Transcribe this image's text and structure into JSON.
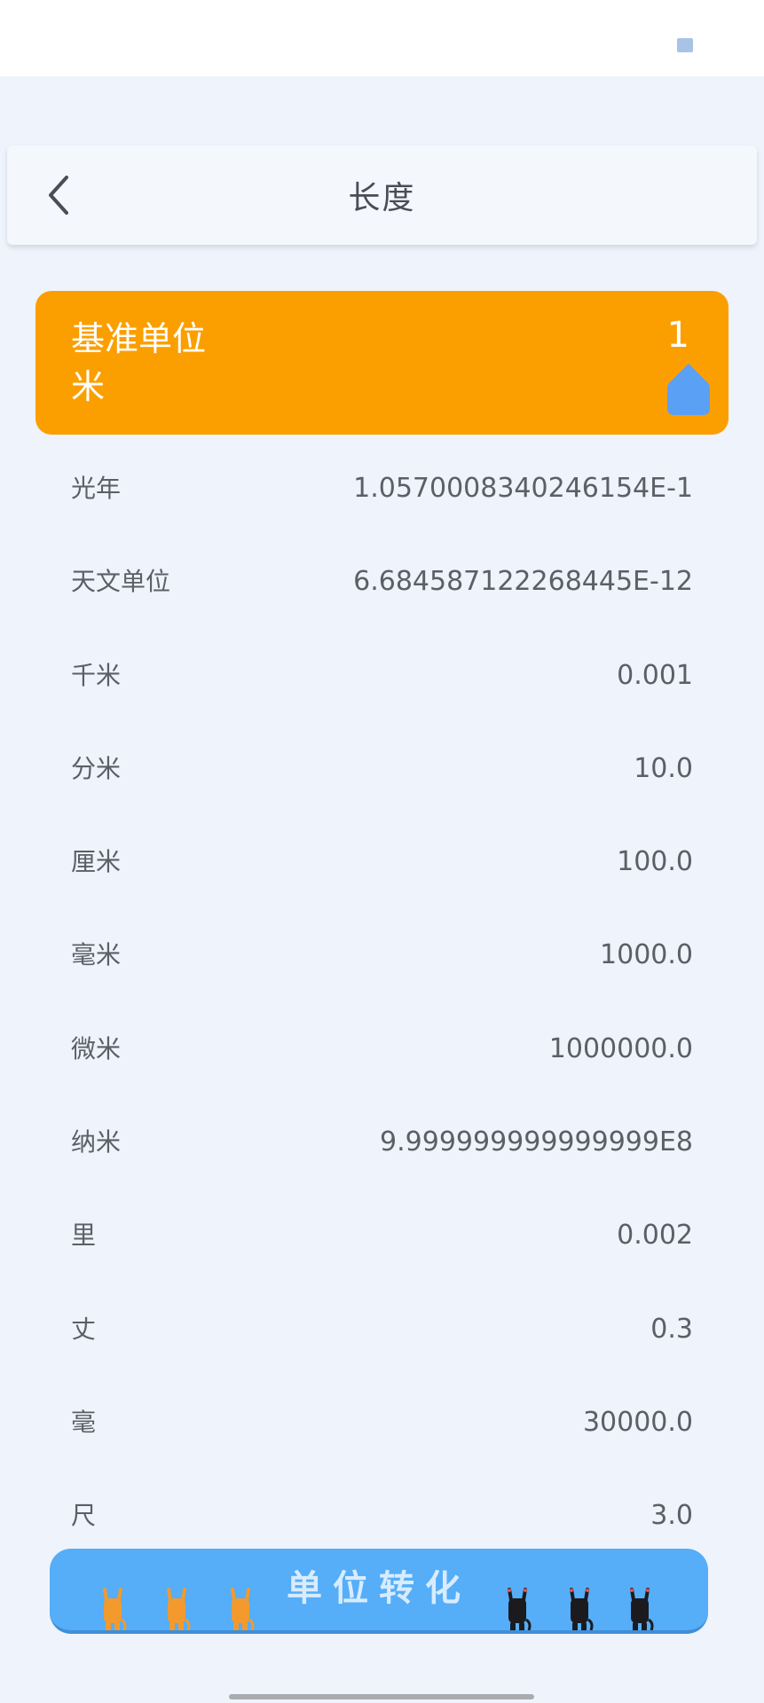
{
  "header": {
    "title": "长度",
    "back_icon": "chevron-left-icon"
  },
  "base": {
    "label": "基准单位",
    "unit": "米",
    "value": "1",
    "edit_icon": "drop-pin-icon",
    "color": "#fb9f00"
  },
  "units": [
    {
      "name": "光年",
      "value": "1.0570008340246154E-1"
    },
    {
      "name": "天文单位",
      "value": "6.684587122268445E-12"
    },
    {
      "name": "千米",
      "value": "0.001"
    },
    {
      "name": "分米",
      "value": "10.0"
    },
    {
      "name": "厘米",
      "value": "100.0"
    },
    {
      "name": "毫米",
      "value": "1000.0"
    },
    {
      "name": "微米",
      "value": "1000000.0"
    },
    {
      "name": "纳米",
      "value": "9.999999999999999E8"
    },
    {
      "name": "里",
      "value": "0.002"
    },
    {
      "name": "丈",
      "value": "0.3"
    },
    {
      "name": "毫",
      "value": "30000.0"
    },
    {
      "name": "尺",
      "value": "3.0"
    }
  ],
  "convert_button": {
    "label": "单位转化",
    "color": "#55aef7"
  },
  "colors": {
    "background": "#eef3fc",
    "accent": "#fb9f00",
    "button": "#55aef7"
  }
}
